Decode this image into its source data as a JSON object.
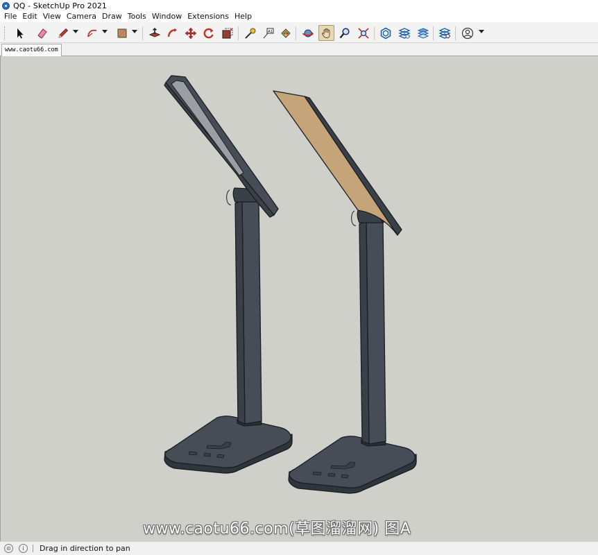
{
  "window": {
    "title": "QQ - SketchUp Pro 2021"
  },
  "menu": {
    "items": [
      {
        "label": "File"
      },
      {
        "label": "Edit"
      },
      {
        "label": "View"
      },
      {
        "label": "Camera"
      },
      {
        "label": "Draw"
      },
      {
        "label": "Tools"
      },
      {
        "label": "Window"
      },
      {
        "label": "Extensions"
      },
      {
        "label": "Help"
      }
    ]
  },
  "toolbar": {
    "tools": [
      {
        "name": "select-icon"
      },
      {
        "name": "eraser-icon"
      },
      {
        "name": "pencil-line-icon"
      },
      {
        "name": "arc-icon"
      },
      {
        "name": "rectangle-icon"
      },
      {
        "name": "push-pull-icon"
      },
      {
        "name": "follow-me-icon"
      },
      {
        "name": "move-icon"
      },
      {
        "name": "rotate-icon"
      },
      {
        "name": "scale-icon"
      },
      {
        "name": "tape-measure-icon"
      },
      {
        "name": "text-icon"
      },
      {
        "name": "paint-bucket-icon"
      },
      {
        "name": "orbit-icon"
      },
      {
        "name": "pan-icon"
      },
      {
        "name": "zoom-icon"
      },
      {
        "name": "zoom-extents-icon"
      },
      {
        "name": "warehouse-icon"
      },
      {
        "name": "extension-warehouse-icon"
      },
      {
        "name": "layout-icon"
      },
      {
        "name": "extension-manager-icon"
      },
      {
        "name": "profile-icon"
      }
    ],
    "active_tool": "pan-icon"
  },
  "scene_tab": {
    "label": "www.caotu66.com"
  },
  "viewport": {
    "background": "#d0d0cb",
    "model_color": "#434a53",
    "edge_color": "#1a1d21",
    "face_back_color": "#c6a47a"
  },
  "watermark": {
    "text": "www.caotu66.com(草图溜溜网) 图A"
  },
  "status": {
    "text": "Drag in direction to pan"
  }
}
